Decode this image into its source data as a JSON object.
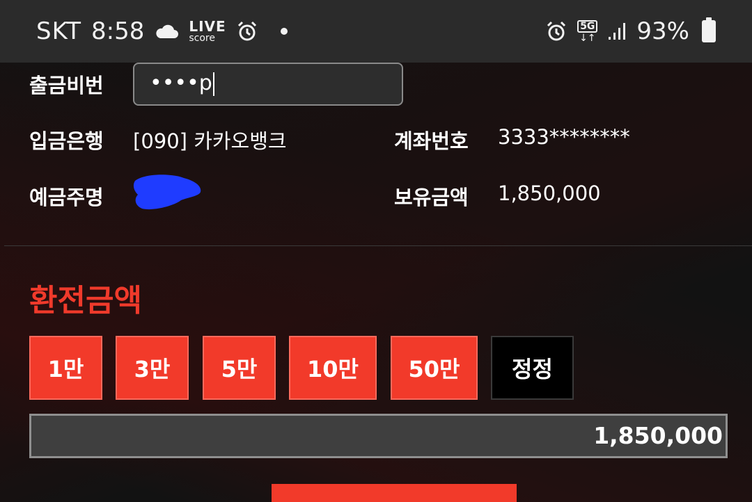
{
  "status_bar": {
    "carrier": "SKT",
    "time": "8:58",
    "live_top": "LIVE",
    "live_bottom": "score",
    "network": "5G",
    "battery": "93%"
  },
  "form": {
    "withdraw_pw_label": "출금비번",
    "withdraw_pw_value": "••••p",
    "bank_label": "입금은행",
    "bank_value": "[090] 카카오뱅크",
    "account_label": "계좌번호",
    "account_value": "3333********",
    "holder_label": "예금주명",
    "balance_label": "보유금액",
    "balance_value": "1,850,000"
  },
  "exchange": {
    "title": "환전금액",
    "buttons": [
      "1만",
      "3만",
      "5만",
      "10만",
      "50만",
      "정정"
    ],
    "amount_value": "1,850,000"
  },
  "colors": {
    "accent": "#f23a2a",
    "background": "#121212",
    "statusbar": "#2b2b2b",
    "redaction": "#1f3cff"
  }
}
